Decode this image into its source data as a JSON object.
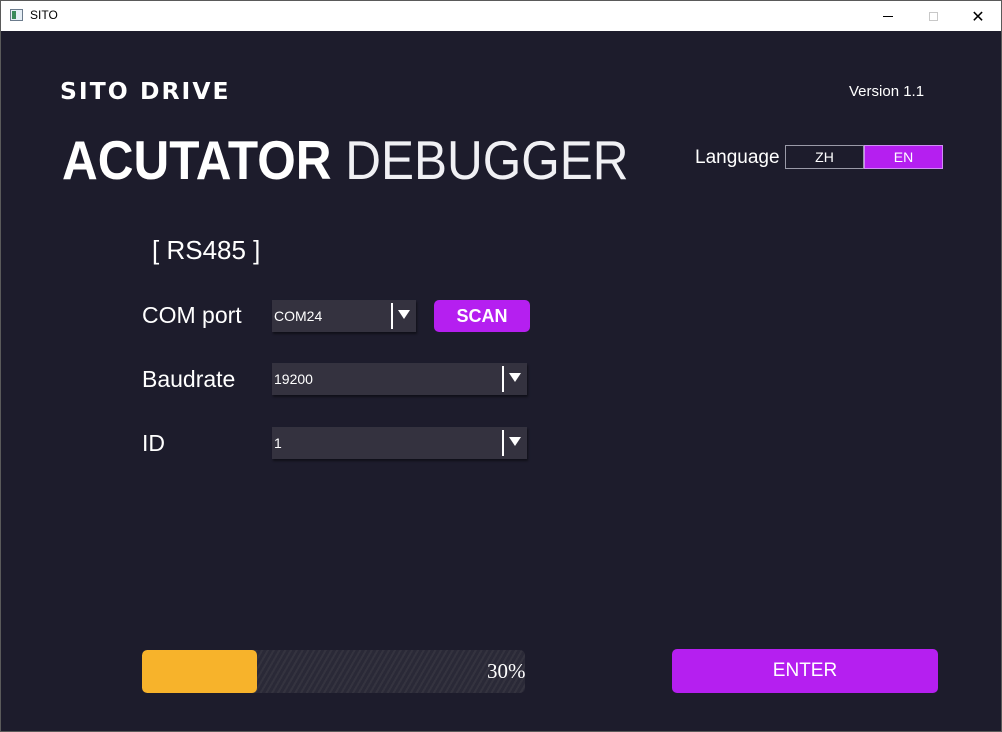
{
  "window": {
    "title": "SITO",
    "minimize_icon": "minimize-icon",
    "maximize_icon": "maximize-icon",
    "close_icon": "close-icon",
    "close_glyph": "✕"
  },
  "header": {
    "brand": "SITO DRIVE",
    "version": "Version 1.1",
    "title_bold": "ACUTATOR",
    "title_thin": "DEBUGGER"
  },
  "language": {
    "label": "Language",
    "options": [
      "ZH",
      "EN"
    ],
    "selected": "EN"
  },
  "form": {
    "section": "[ RS485 ]",
    "com_port": {
      "label": "COM port",
      "value": "COM24"
    },
    "scan_label": "SCAN",
    "baudrate": {
      "label": "Baudrate",
      "value": "19200"
    },
    "id": {
      "label": "ID",
      "value": "1"
    }
  },
  "progress": {
    "percent": 30,
    "text": "30%"
  },
  "enter_label": "ENTER",
  "colors": {
    "background": "#1d1c2c",
    "accent": "#b51ff0",
    "progress": "#f7b32b",
    "field": "#34323f"
  }
}
